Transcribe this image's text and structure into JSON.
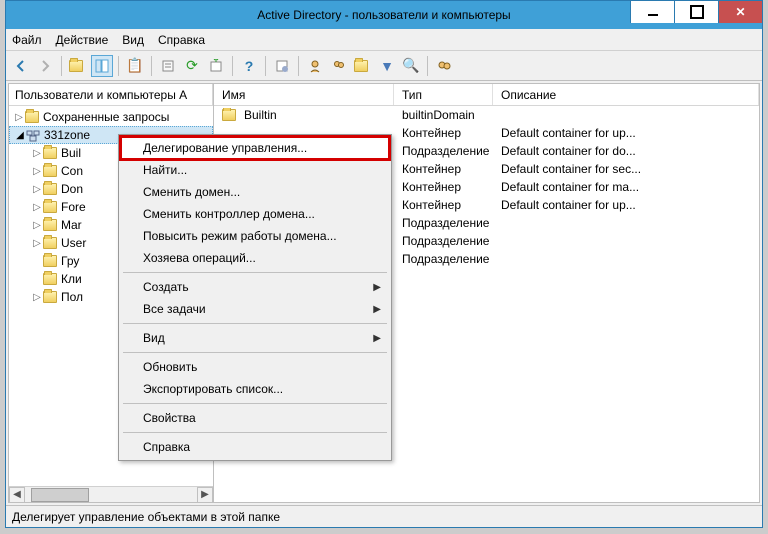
{
  "window": {
    "title": "Active Directory - пользователи и компьютеры"
  },
  "menubar": {
    "file": "Файл",
    "action": "Действие",
    "view": "Вид",
    "help": "Справка"
  },
  "tree": {
    "header": "Пользователи и компьютеры A",
    "saved_queries": "Сохраненные запросы",
    "domain": "331zone",
    "children": {
      "builtin": "Buil",
      "computers": "Con",
      "domain_controllers": "Don",
      "foreign": "Fore",
      "managed": "Mar",
      "users": "User",
      "groups": "Гру",
      "clients": "Кли",
      "others": "Пол"
    }
  },
  "columns": {
    "name": "Имя",
    "type": "Тип",
    "desc": "Описание"
  },
  "rows": [
    {
      "name": "Builtin",
      "type": "builtinDomain",
      "desc": ""
    },
    {
      "name": "",
      "type": "Контейнер",
      "desc": "Default container for up..."
    },
    {
      "name": "",
      "type": "Подразделение",
      "desc": "Default container for do..."
    },
    {
      "name": "",
      "type": "Контейнер",
      "desc": "Default container for sec..."
    },
    {
      "name": "",
      "type": "Контейнер",
      "desc": "Default container for ma..."
    },
    {
      "name": "",
      "type": "Контейнер",
      "desc": "Default container for up..."
    },
    {
      "name": "",
      "type": "Подразделение",
      "desc": ""
    },
    {
      "name": "",
      "type": "Подразделение",
      "desc": ""
    },
    {
      "name": "",
      "type": "Подразделение",
      "desc": ""
    }
  ],
  "context_menu": {
    "delegate": "Делегирование управления...",
    "find": "Найти...",
    "change_domain": "Сменить домен...",
    "change_dc": "Сменить контроллер домена...",
    "raise_level": "Повысить режим работы домена...",
    "op_masters": "Хозяева операций...",
    "create": "Создать",
    "all_tasks": "Все задачи",
    "view": "Вид",
    "refresh": "Обновить",
    "export": "Экспортировать список...",
    "properties": "Свойства",
    "help": "Справка"
  },
  "statusbar": {
    "text": "Делегирует управление объектами в этой папке"
  },
  "scroll_thumb_label": "|||"
}
